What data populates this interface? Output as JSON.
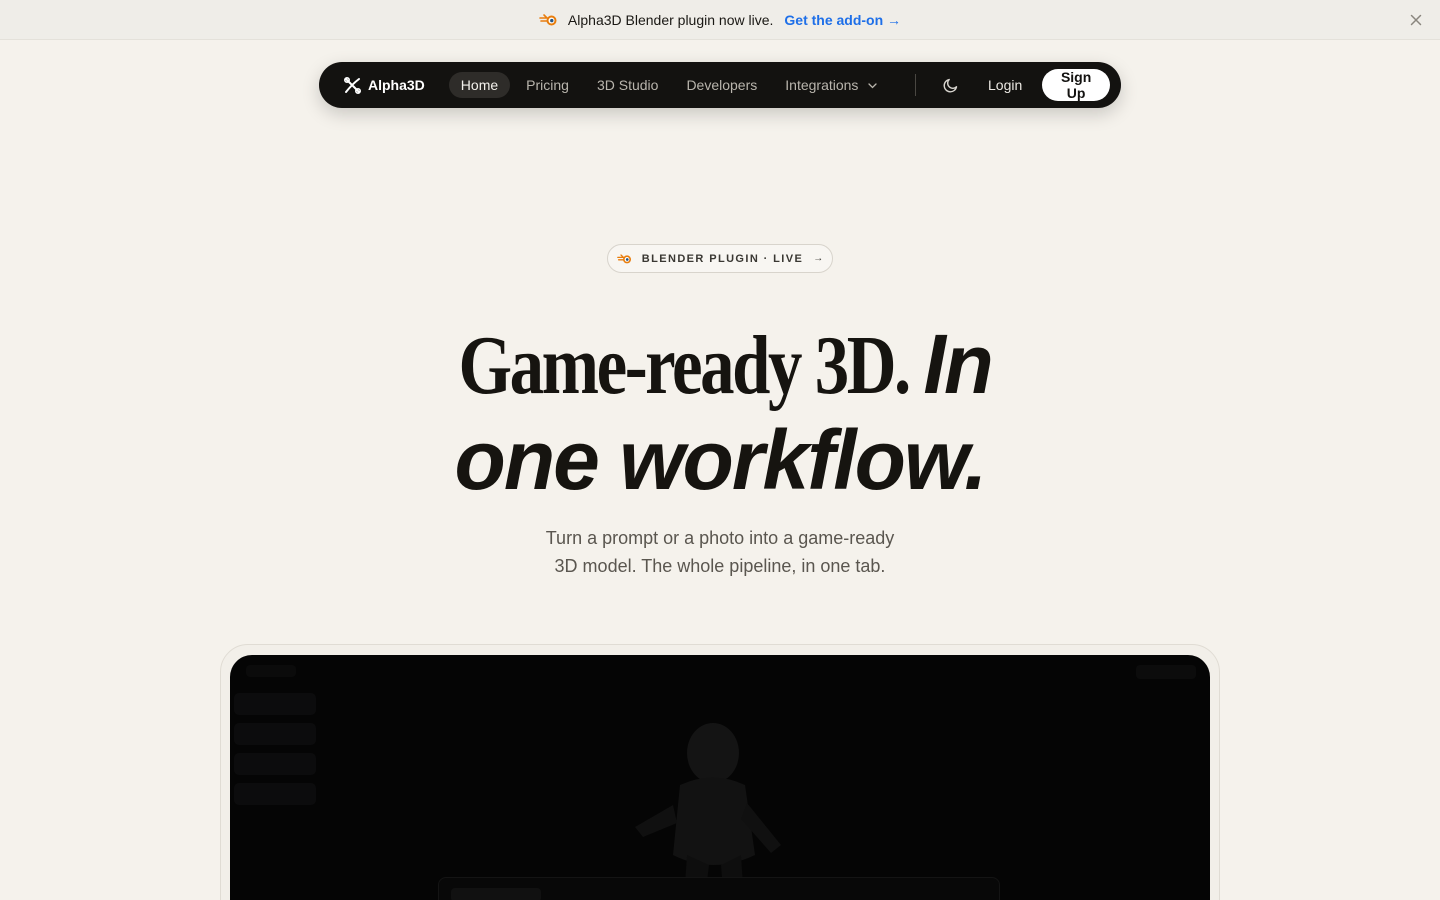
{
  "announcement": {
    "message": "Alpha3D Blender plugin now live.",
    "link_label": "Get the add-on →",
    "icons": {
      "brand": "blender-icon",
      "close": "close-icon"
    },
    "colors": {
      "link": "#1e6fe8"
    }
  },
  "nav": {
    "brand": "Alpha3D",
    "items": [
      {
        "label": "Home",
        "active": true
      },
      {
        "label": "Pricing"
      },
      {
        "label": "3D Studio"
      },
      {
        "label": "Developers"
      },
      {
        "label": "Integrations",
        "has_dropdown": true
      }
    ],
    "theme_toggle_icon": "moon-icon",
    "login_label": "Login",
    "signup_label": "Sign Up"
  },
  "hero": {
    "badge_label": "BLENDER PLUGIN · LIVE",
    "badge_arrow": "→",
    "heading_serif": "Game-ready 3D.",
    "heading_italic_1": "In",
    "heading_italic_2": "one workflow.",
    "subtitle_line1": "Turn a prompt or a photo into a game-ready",
    "subtitle_line2": "3D model. The whole pipeline, in one tab."
  },
  "theme": {
    "background": "#f5f2ec",
    "nav_background": "#131210",
    "text": "#161410",
    "preview_background": "#050505"
  }
}
